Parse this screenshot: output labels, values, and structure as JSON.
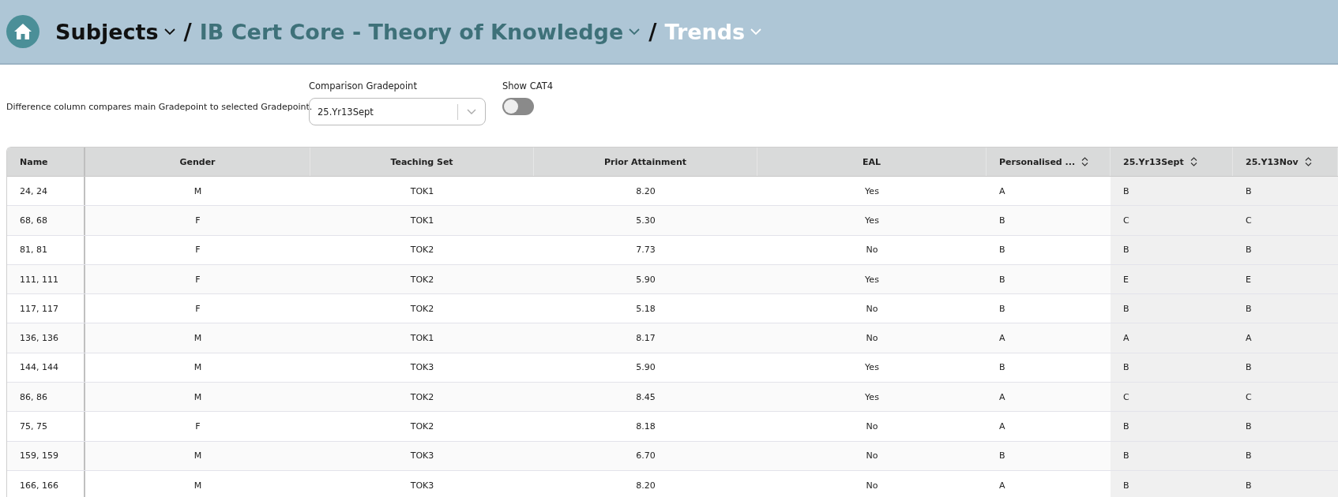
{
  "breadcrumb": {
    "separator": "/",
    "items": [
      {
        "label": "Subjects",
        "kind": "root"
      },
      {
        "label": "IB Cert Core - Theory of Knowledge",
        "kind": "parent"
      },
      {
        "label": "Trends",
        "kind": "current"
      }
    ]
  },
  "note": "Difference column compares main Gradepoint to selected Gradepoint.",
  "comparison": {
    "label": "Comparison Gradepoint",
    "value": "25.Yr13Sept"
  },
  "cat4": {
    "label": "Show CAT4",
    "on": false
  },
  "table": {
    "columns": [
      {
        "label": "Name",
        "sortable": false
      },
      {
        "label": "Gender",
        "sortable": false
      },
      {
        "label": "Teaching Set",
        "sortable": false
      },
      {
        "label": "Prior Attainment",
        "sortable": false
      },
      {
        "label": "EAL",
        "sortable": false
      },
      {
        "label": "Personalised ...",
        "sortable": true
      },
      {
        "label": "25.Yr13Sept",
        "sortable": true
      },
      {
        "label": "25.Y13Nov",
        "sortable": true
      }
    ],
    "rows": [
      [
        "24, 24",
        "M",
        "TOK1",
        "8.20",
        "Yes",
        "A",
        "B",
        "B"
      ],
      [
        "68, 68",
        "F",
        "TOK1",
        "5.30",
        "Yes",
        "B",
        "C",
        "C"
      ],
      [
        "81, 81",
        "F",
        "TOK2",
        "7.73",
        "No",
        "B",
        "B",
        "B"
      ],
      [
        "111, 111",
        "F",
        "TOK2",
        "5.90",
        "Yes",
        "B",
        "E",
        "E"
      ],
      [
        "117, 117",
        "F",
        "TOK2",
        "5.18",
        "No",
        "B",
        "B",
        "B"
      ],
      [
        "136, 136",
        "M",
        "TOK1",
        "8.17",
        "No",
        "A",
        "A",
        "A"
      ],
      [
        "144, 144",
        "M",
        "TOK3",
        "5.90",
        "Yes",
        "B",
        "B",
        "B"
      ],
      [
        "86, 86",
        "M",
        "TOK2",
        "8.45",
        "Yes",
        "A",
        "C",
        "C"
      ],
      [
        "75, 75",
        "F",
        "TOK2",
        "8.18",
        "No",
        "A",
        "B",
        "B"
      ],
      [
        "159, 159",
        "M",
        "TOK3",
        "6.70",
        "No",
        "B",
        "B",
        "B"
      ],
      [
        "166, 166",
        "M",
        "TOK3",
        "8.20",
        "No",
        "A",
        "B",
        "B"
      ]
    ]
  }
}
